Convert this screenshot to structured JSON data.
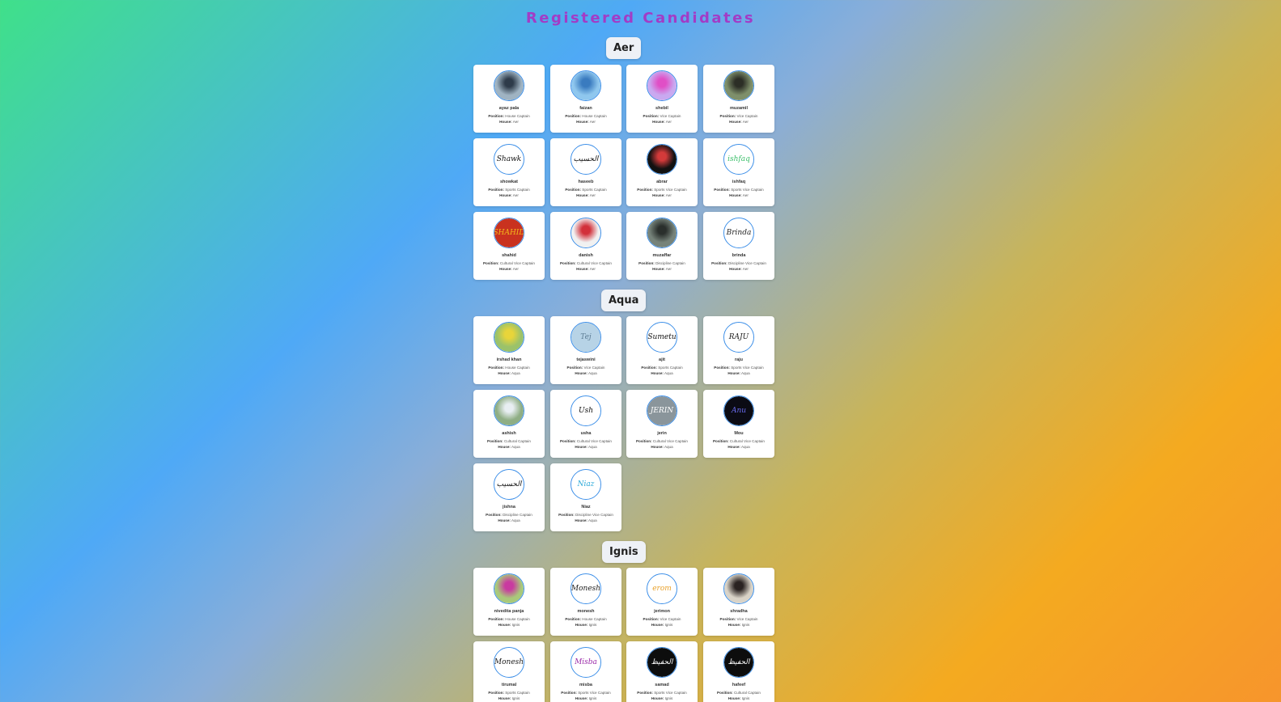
{
  "page_title": "Registered Candidates",
  "labels": {
    "position": "Position:",
    "house": "House:"
  },
  "houses": [
    {
      "name": "Aer",
      "candidates": [
        {
          "name": "ayaz pala",
          "position": "House Captain",
          "house": "Aer",
          "avatar": "photo-person-icon",
          "bg": "#9fb3c2",
          "fg": "#2e3b4a"
        },
        {
          "name": "faizan",
          "position": "House Captain",
          "house": "Aer",
          "avatar": "photo-person-icon",
          "bg": "#8fc7ee",
          "fg": "#3a7bbf"
        },
        {
          "name": "shebil",
          "position": "Vice Captain",
          "house": "Aer",
          "avatar": "book-cover-icon",
          "bg": "#c9a9f0",
          "fg": "#e04fc6"
        },
        {
          "name": "muzamil",
          "position": "Vice Captain",
          "house": "Aer",
          "avatar": "photo-person-icon",
          "bg": "#7e8f6a",
          "fg": "#2c2e26"
        },
        {
          "name": "showkat",
          "position": "Sports Captain",
          "house": "Aer",
          "avatar": "signature-icon",
          "bg": "#ffffff",
          "fg": "#111111",
          "mark": "Shawk"
        },
        {
          "name": "haseeb",
          "position": "Sports Captain",
          "house": "Aer",
          "avatar": "calligraphy-icon",
          "bg": "#ffffff",
          "fg": "#111111",
          "mark": "الحسيب"
        },
        {
          "name": "abrar",
          "position": "Sports Vice Captain",
          "house": "Aer",
          "avatar": "art-icon",
          "bg": "#111111",
          "fg": "#d33a3a"
        },
        {
          "name": "ishfaq",
          "position": "Sports Vice Captain",
          "house": "Aer",
          "avatar": "text-logo-icon",
          "bg": "#ffffff",
          "fg": "#3bbf6a",
          "mark": "ishfaq"
        },
        {
          "name": "shahid",
          "position": "Cultural Vice Captain",
          "house": "Aer",
          "avatar": "flower-logo-icon",
          "bg": "#c9321f",
          "fg": "#f2b81c",
          "mark": "SHAHID"
        },
        {
          "name": "danish",
          "position": "Cultural Vice Captain",
          "house": "Aer",
          "avatar": "mug-icon",
          "bg": "#f1f1f1",
          "fg": "#d2303a"
        },
        {
          "name": "muzaffar",
          "position": "Discipline Captain",
          "house": "Aer",
          "avatar": "photo-person-icon",
          "bg": "#76837a",
          "fg": "#2a2f2c"
        },
        {
          "name": "brinda",
          "position": "Discipline Vice Captain",
          "house": "Aer",
          "avatar": "signature-icon",
          "bg": "#ffffff",
          "fg": "#222222",
          "mark": "Brinda"
        }
      ]
    },
    {
      "name": "Aqua",
      "candidates": [
        {
          "name": "irshad khan",
          "position": "House Captain",
          "house": "Aqua",
          "avatar": "photo-outdoor-icon",
          "bg": "#9bc26a",
          "fg": "#e8d53a"
        },
        {
          "name": "tejaswini",
          "position": "Vice Captain",
          "house": "Aqua",
          "avatar": "sky-icon",
          "bg": "#b7d3e6",
          "fg": "#5d7d94",
          "mark": "Tej"
        },
        {
          "name": "ajit",
          "position": "Sports Captain",
          "house": "Aqua",
          "avatar": "signature-icon",
          "bg": "#ffffff",
          "fg": "#111111",
          "mark": "Sumetu"
        },
        {
          "name": "raju",
          "position": "Sports Vice Captain",
          "house": "Aqua",
          "avatar": "text-logo-icon",
          "bg": "#ffffff",
          "fg": "#222222",
          "mark": "RAJU"
        },
        {
          "name": "ashish",
          "position": "Cultural Captain",
          "house": "Aqua",
          "avatar": "photo-outdoor-icon",
          "bg": "#8fae84",
          "fg": "#e8eef2"
        },
        {
          "name": "usha",
          "position": "Cultural Vice Captain",
          "house": "Aqua",
          "avatar": "text-logo-icon",
          "bg": "#ffffff",
          "fg": "#111111",
          "mark": "Ush"
        },
        {
          "name": "jerin",
          "position": "Cultural Vice Captain",
          "house": "Aqua",
          "avatar": "text-logo-icon",
          "bg": "#8a959b",
          "fg": "#ffffff",
          "mark": "JERIN"
        },
        {
          "name": "Mou",
          "position": "Cultural Vice Captain",
          "house": "Aqua",
          "avatar": "text-logo-icon",
          "bg": "#0b0b14",
          "fg": "#6a6cf0",
          "mark": "Anu"
        },
        {
          "name": "jishna",
          "position": "Discipline Captain",
          "house": "Aqua",
          "avatar": "calligraphy-icon",
          "bg": "#ffffff",
          "fg": "#111111",
          "mark": "الحسيب"
        },
        {
          "name": "Niaz",
          "position": "Discipline Vice Captain",
          "house": "Aqua",
          "avatar": "text-logo-icon",
          "bg": "#ffffff",
          "fg": "#2aa8d8",
          "mark": "Niaz"
        }
      ]
    },
    {
      "name": "Ignis",
      "candidates": [
        {
          "name": "nivedita panja",
          "position": "House Captain",
          "house": "Ignis",
          "avatar": "photo-person-icon",
          "bg": "#a9c97a",
          "fg": "#c93aa0"
        },
        {
          "name": "monesh",
          "position": "House Captain",
          "house": "Ignis",
          "avatar": "signature-icon",
          "bg": "#ffffff",
          "fg": "#222222",
          "mark": "Monesh"
        },
        {
          "name": "jerimon",
          "position": "Vice Captain",
          "house": "Ignis",
          "avatar": "text-logo-icon",
          "bg": "#ffffff",
          "fg": "#e9a12a",
          "mark": "erom"
        },
        {
          "name": "shradha",
          "position": "Vice Captain",
          "house": "Ignis",
          "avatar": "photo-person-icon",
          "bg": "#d9d3c7",
          "fg": "#2a2322"
        },
        {
          "name": "tirumal",
          "position": "Sports Captain",
          "house": "Ignis",
          "avatar": "signature-icon",
          "bg": "#ffffff",
          "fg": "#222222",
          "mark": "Monesh"
        },
        {
          "name": "misba",
          "position": "Sports Vice Captain",
          "house": "Ignis",
          "avatar": "text-logo-icon",
          "bg": "#ffffff",
          "fg": "#9a2aa8",
          "mark": "Misba"
        },
        {
          "name": "samad",
          "position": "Sports Vice Captain",
          "house": "Ignis",
          "avatar": "calligraphy-icon",
          "bg": "#0d0d0d",
          "fg": "#ffffff",
          "mark": "الحفيظ"
        },
        {
          "name": "hafeef",
          "position": "Cultural Captain",
          "house": "Ignis",
          "avatar": "calligraphy-icon",
          "bg": "#0d0d0d",
          "fg": "#ffffff",
          "mark": "الحفيظ"
        }
      ]
    }
  ]
}
